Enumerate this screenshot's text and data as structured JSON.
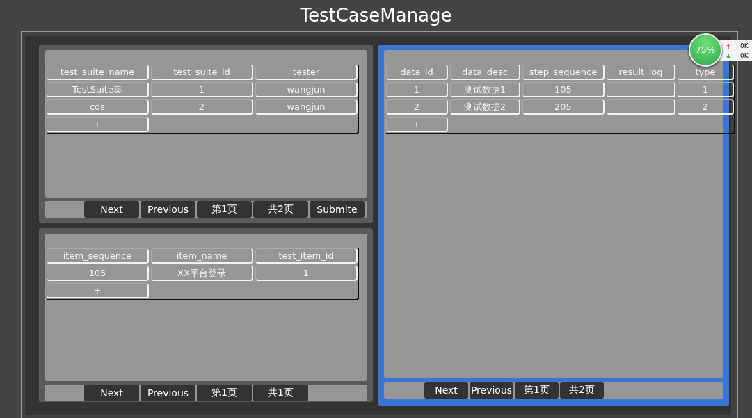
{
  "title": "TestCaseManage",
  "left_panels": [
    {
      "selected": false,
      "columns": [
        "test_suite_name",
        "test_suite_id",
        "tester"
      ],
      "rows": [
        [
          "TestSuite集",
          "1",
          "wangjun"
        ],
        [
          "cds",
          "2",
          "wangjun"
        ]
      ],
      "add": "+",
      "buttons": [
        "Next",
        "Previous",
        "第1页",
        "共2页",
        "Submite"
      ]
    },
    {
      "selected": false,
      "columns": [
        "item_sequence",
        "item_name",
        "test_item_id"
      ],
      "rows": [
        [
          "105",
          "XX平台登录",
          "1"
        ]
      ],
      "add": "+",
      "buttons": [
        "Next",
        "Previous",
        "第1页",
        "共1页"
      ]
    }
  ],
  "right_panel": {
    "selected": true,
    "columns": [
      "data_id",
      "data_desc",
      "step_sequence",
      "result_log",
      "type"
    ],
    "rows": [
      [
        "1",
        "测试数据1",
        "105",
        "",
        "1"
      ],
      [
        "2",
        "测试数据2",
        "205",
        "",
        "2"
      ]
    ],
    "add": "+",
    "buttons": [
      "Next",
      "Previous",
      "第1页",
      "共2页"
    ]
  },
  "speed_widget": {
    "percent": "75%",
    "upload": "0K",
    "download": "0K"
  }
}
